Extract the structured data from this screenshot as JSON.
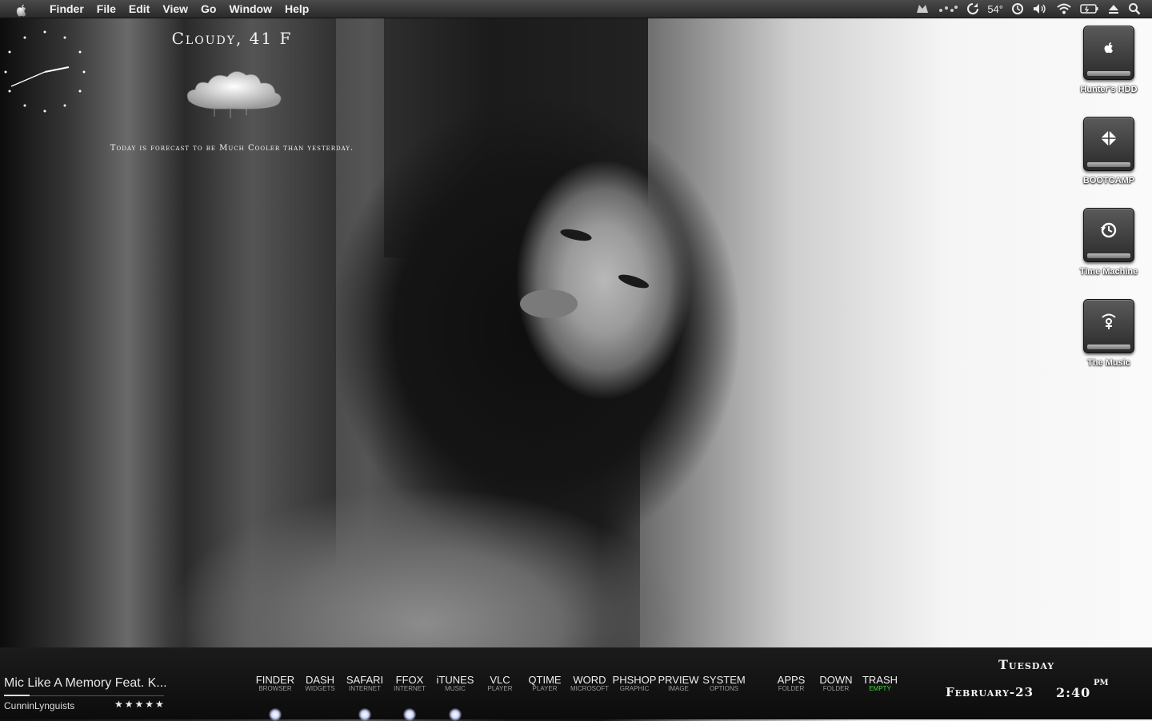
{
  "menubar": {
    "app_name": "Finder",
    "menus": [
      "File",
      "Edit",
      "View",
      "Go",
      "Window",
      "Help"
    ],
    "status": {
      "temperature": "54°"
    }
  },
  "weather": {
    "title": "Cloudy, 41 F",
    "forecast": "Today is forecast to be Much Cooler than yesterday."
  },
  "drives": [
    {
      "label": "Hunter's HDD",
      "icon": "apple-icon"
    },
    {
      "label": "BOOTCAMP",
      "icon": "windows-icon"
    },
    {
      "label": "Time Machine",
      "icon": "time-machine-icon"
    },
    {
      "label": "The Music",
      "icon": "firewire-icon"
    }
  ],
  "now_playing": {
    "track": "Mic Like A Memory Feat. K...",
    "artist": "CunninLynguists",
    "rating_text": "★★★★★",
    "progress": 0.16
  },
  "dock": {
    "items": [
      {
        "name": "FINDER",
        "sub": "BROWSER"
      },
      {
        "name": "DASH",
        "sub": "WIDGETS"
      },
      {
        "name": "SAFARI",
        "sub": "INTERNET"
      },
      {
        "name": "FFOX",
        "sub": "INTERNET"
      },
      {
        "name": "iTUNES",
        "sub": "MUSIC"
      },
      {
        "name": "VLC",
        "sub": "PLAYER"
      },
      {
        "name": "QTIME",
        "sub": "PLAYER"
      },
      {
        "name": "WORD",
        "sub": "MICROSOFT"
      },
      {
        "name": "PHSHOP",
        "sub": "GRAPHIC"
      },
      {
        "name": "PRVIEW",
        "sub": "IMAGE"
      },
      {
        "name": "SYSTEM",
        "sub": "OPTIONS"
      },
      {
        "name": "APPS",
        "sub": "FOLDER"
      },
      {
        "name": "DOWN",
        "sub": "FOLDER"
      },
      {
        "name": "TRASH",
        "sub": "EMPTY"
      }
    ]
  },
  "datetime": {
    "day": "Tuesday",
    "date": "February-23",
    "time": "2:40",
    "ampm": "PM"
  }
}
